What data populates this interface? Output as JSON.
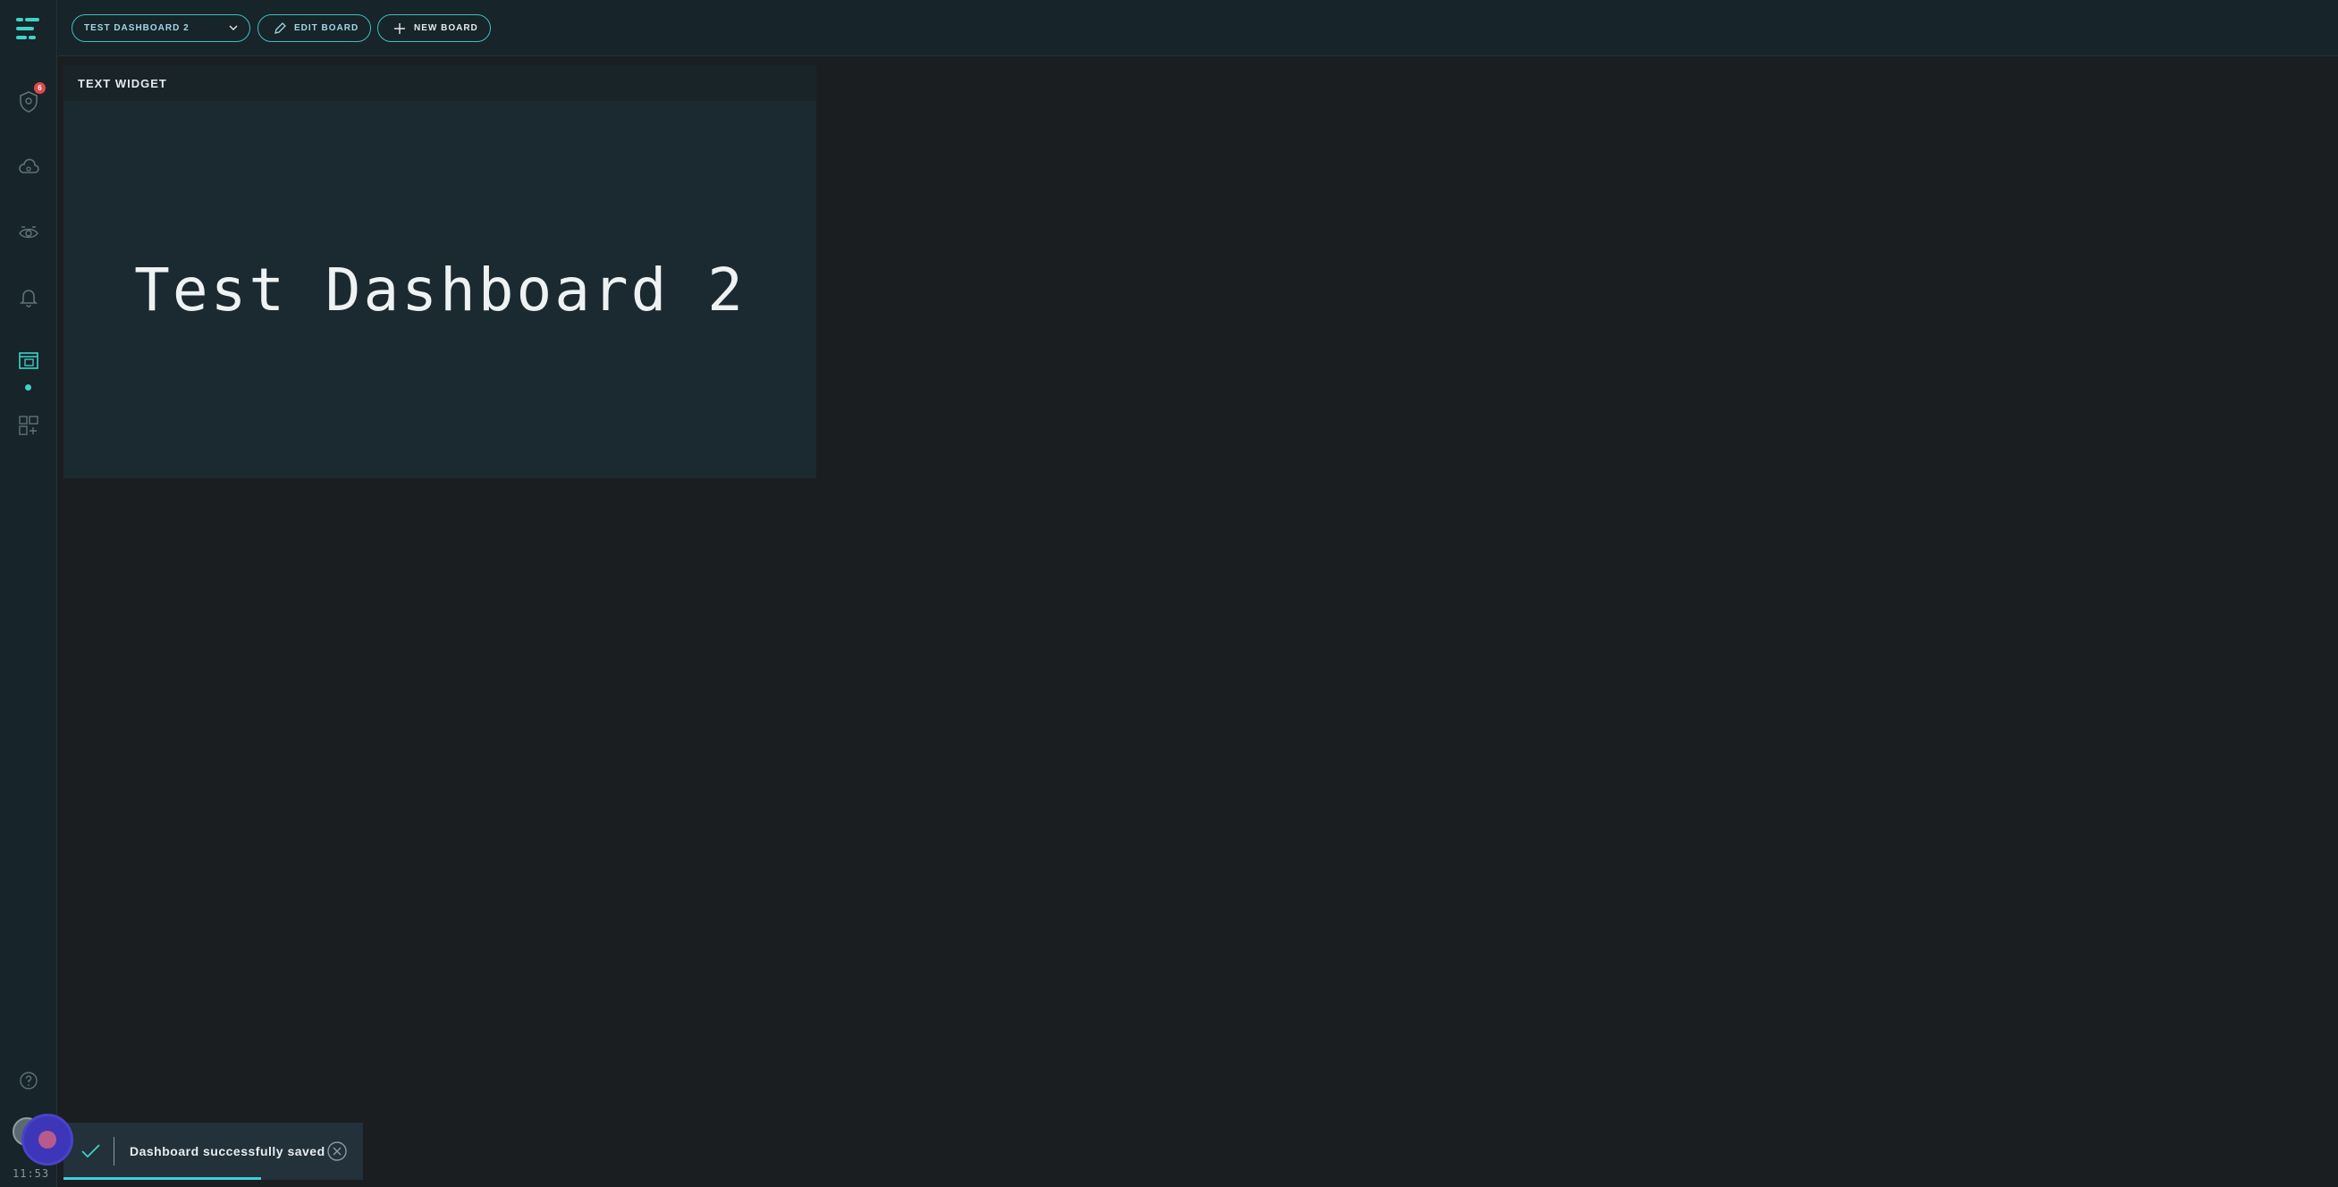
{
  "topbar": {
    "board_select": "TEST DASHBOARD 2",
    "edit_board": "EDIT BOARD",
    "new_board": "NEW BOARD"
  },
  "sidebar": {
    "items": [
      {
        "icon": "shield-alert-icon",
        "badge": "6"
      },
      {
        "icon": "cloud-icon"
      },
      {
        "icon": "eye-scan-icon"
      },
      {
        "icon": "bell-icon"
      },
      {
        "icon": "dashboard-icon",
        "active": true
      },
      {
        "icon": "add-widget-icon"
      }
    ],
    "clock": "11:53"
  },
  "widget": {
    "header": "TEXT WIDGET",
    "text": "Test Dashboard 2"
  },
  "toast": {
    "message": "Dashboard successfully saved",
    "progress": 0.66
  },
  "colors": {
    "accent": "#3fbfc2",
    "background": "#1a1e21",
    "panel": "#172429",
    "badge": "#e0484c",
    "record": "#3d36b8"
  }
}
